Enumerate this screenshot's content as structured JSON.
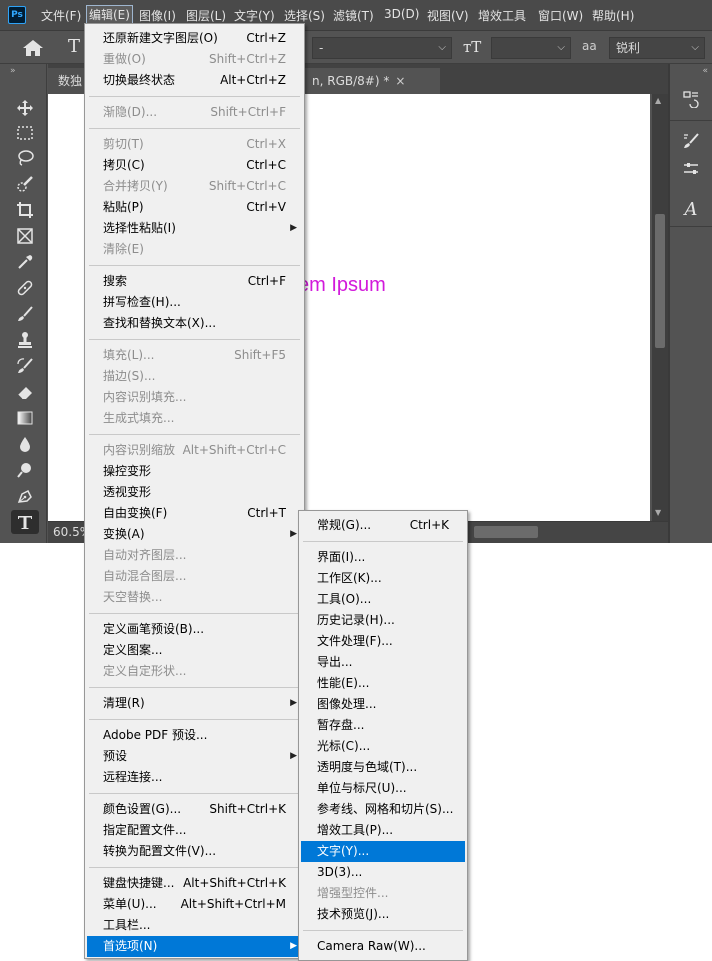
{
  "menubar": {
    "logo": "Ps",
    "items": [
      {
        "label": "文件(F)"
      },
      {
        "label": "编辑(E)"
      },
      {
        "label": "图像(I)"
      },
      {
        "label": "图层(L)"
      },
      {
        "label": "文字(Y)"
      },
      {
        "label": "选择(S)"
      },
      {
        "label": "滤镜(T)"
      },
      {
        "label": "3D(D)"
      },
      {
        "label": "视图(V)"
      },
      {
        "label": "增效工具"
      },
      {
        "label": "窗口(W)"
      },
      {
        "label": "帮助(H)"
      }
    ]
  },
  "options": {
    "style_value": "-",
    "size_value": "",
    "antialias_value": "锐利",
    "aa_label": "aa",
    "tool_glyph": "T",
    "size_glyph": "тT"
  },
  "document": {
    "tab1": "数独",
    "tab2": "n, RGB/8#) *",
    "close": "×",
    "canvas_text": "em Ipsum",
    "zoom": "60.5",
    "text_color": "#d21adb"
  },
  "toolbar": {
    "collapse": "»",
    "tools": [
      "move-tool",
      "marquee-tool",
      "lasso-tool",
      "quick-select-tool",
      "crop-tool",
      "frame-tool",
      "eyedropper-tool",
      "healing-tool",
      "brush-tool",
      "stamp-tool",
      "history-brush-tool",
      "eraser-tool",
      "gradient-tool",
      "blur-tool",
      "dodge-tool",
      "pen-tool",
      "type-tool"
    ],
    "selected": "type-tool"
  },
  "edit_menu": {
    "items": [
      {
        "label": "还原新建文字图层(O)",
        "shortcut": "Ctrl+Z",
        "disabled": false
      },
      {
        "label": "重做(O)",
        "shortcut": "Shift+Ctrl+Z",
        "disabled": true
      },
      {
        "label": "切换最终状态",
        "shortcut": "Alt+Ctrl+Z",
        "disabled": false
      },
      {
        "label": "渐隐(D)...",
        "shortcut": "Shift+Ctrl+F",
        "disabled": true
      },
      {
        "label": "剪切(T)",
        "shortcut": "Ctrl+X",
        "disabled": true
      },
      {
        "label": "拷贝(C)",
        "shortcut": "Ctrl+C",
        "disabled": false
      },
      {
        "label": "合并拷贝(Y)",
        "shortcut": "Shift+Ctrl+C",
        "disabled": true
      },
      {
        "label": "粘贴(P)",
        "shortcut": "Ctrl+V",
        "disabled": false
      },
      {
        "label": "选择性粘贴(I)",
        "shortcut": "",
        "disabled": false,
        "submenu": true
      },
      {
        "label": "清除(E)",
        "shortcut": "",
        "disabled": true
      },
      {
        "label": "搜索",
        "shortcut": "Ctrl+F",
        "disabled": false
      },
      {
        "label": "拼写检查(H)...",
        "shortcut": "",
        "disabled": false
      },
      {
        "label": "查找和替换文本(X)...",
        "shortcut": "",
        "disabled": false
      },
      {
        "label": "填充(L)...",
        "shortcut": "Shift+F5",
        "disabled": true
      },
      {
        "label": "描边(S)...",
        "shortcut": "",
        "disabled": true
      },
      {
        "label": "内容识别填充...",
        "shortcut": "",
        "disabled": true
      },
      {
        "label": "生成式填充...",
        "shortcut": "",
        "disabled": true
      },
      {
        "label": "内容识别缩放",
        "shortcut": "Alt+Shift+Ctrl+C",
        "disabled": true
      },
      {
        "label": "操控变形",
        "shortcut": "",
        "disabled": false
      },
      {
        "label": "透视变形",
        "shortcut": "",
        "disabled": false
      },
      {
        "label": "自由变换(F)",
        "shortcut": "Ctrl+T",
        "disabled": false
      },
      {
        "label": "变换(A)",
        "shortcut": "",
        "disabled": false,
        "submenu": true
      },
      {
        "label": "自动对齐图层...",
        "shortcut": "",
        "disabled": true
      },
      {
        "label": "自动混合图层...",
        "shortcut": "",
        "disabled": true
      },
      {
        "label": "天空替换...",
        "shortcut": "",
        "disabled": true
      },
      {
        "label": "定义画笔预设(B)...",
        "shortcut": "",
        "disabled": false
      },
      {
        "label": "定义图案...",
        "shortcut": "",
        "disabled": false
      },
      {
        "label": "定义自定形状...",
        "shortcut": "",
        "disabled": true
      },
      {
        "label": "清理(R)",
        "shortcut": "",
        "disabled": false,
        "submenu": true
      },
      {
        "label": "Adobe PDF 预设...",
        "shortcut": "",
        "disabled": false
      },
      {
        "label": "预设",
        "shortcut": "",
        "disabled": false,
        "submenu": true
      },
      {
        "label": "远程连接...",
        "shortcut": "",
        "disabled": false
      },
      {
        "label": "颜色设置(G)...",
        "shortcut": "Shift+Ctrl+K",
        "disabled": false
      },
      {
        "label": "指定配置文件...",
        "shortcut": "",
        "disabled": false
      },
      {
        "label": "转换为配置文件(V)...",
        "shortcut": "",
        "disabled": false
      },
      {
        "label": "键盘快捷键...",
        "shortcut": "Alt+Shift+Ctrl+K",
        "disabled": false
      },
      {
        "label": "菜单(U)...",
        "shortcut": "Alt+Shift+Ctrl+M",
        "disabled": false
      },
      {
        "label": "工具栏...",
        "shortcut": "",
        "disabled": false
      },
      {
        "label": "首选项(N)",
        "shortcut": "",
        "disabled": false,
        "submenu": true,
        "highlighted": true
      }
    ]
  },
  "prefs_menu": {
    "items": [
      {
        "label": "常规(G)...",
        "shortcut": "Ctrl+K",
        "disabled": false
      },
      {
        "label": "界面(I)...",
        "shortcut": "",
        "disabled": false
      },
      {
        "label": "工作区(K)...",
        "shortcut": "",
        "disabled": false
      },
      {
        "label": "工具(O)...",
        "shortcut": "",
        "disabled": false
      },
      {
        "label": "历史记录(H)...",
        "shortcut": "",
        "disabled": false
      },
      {
        "label": "文件处理(F)...",
        "shortcut": "",
        "disabled": false
      },
      {
        "label": "导出...",
        "shortcut": "",
        "disabled": false
      },
      {
        "label": "性能(E)...",
        "shortcut": "",
        "disabled": false
      },
      {
        "label": "图像处理...",
        "shortcut": "",
        "disabled": false
      },
      {
        "label": "暂存盘...",
        "shortcut": "",
        "disabled": false
      },
      {
        "label": "光标(C)...",
        "shortcut": "",
        "disabled": false
      },
      {
        "label": "透明度与色域(T)...",
        "shortcut": "",
        "disabled": false
      },
      {
        "label": "单位与标尺(U)...",
        "shortcut": "",
        "disabled": false
      },
      {
        "label": "参考线、网格和切片(S)...",
        "shortcut": "",
        "disabled": false
      },
      {
        "label": "增效工具(P)...",
        "shortcut": "",
        "disabled": false
      },
      {
        "label": "文字(Y)...",
        "shortcut": "",
        "disabled": false,
        "highlighted": true
      },
      {
        "label": "3D(3)...",
        "shortcut": "",
        "disabled": false
      },
      {
        "label": "增强型控件...",
        "shortcut": "",
        "disabled": true
      },
      {
        "label": "技术预览(J)...",
        "shortcut": "",
        "disabled": false
      },
      {
        "label": "Camera Raw(W)...",
        "shortcut": "",
        "disabled": false
      }
    ]
  },
  "colors": {
    "highlight": "#0078d7",
    "menu_bg": "#f0f0f0",
    "app_bg": "#535353"
  }
}
